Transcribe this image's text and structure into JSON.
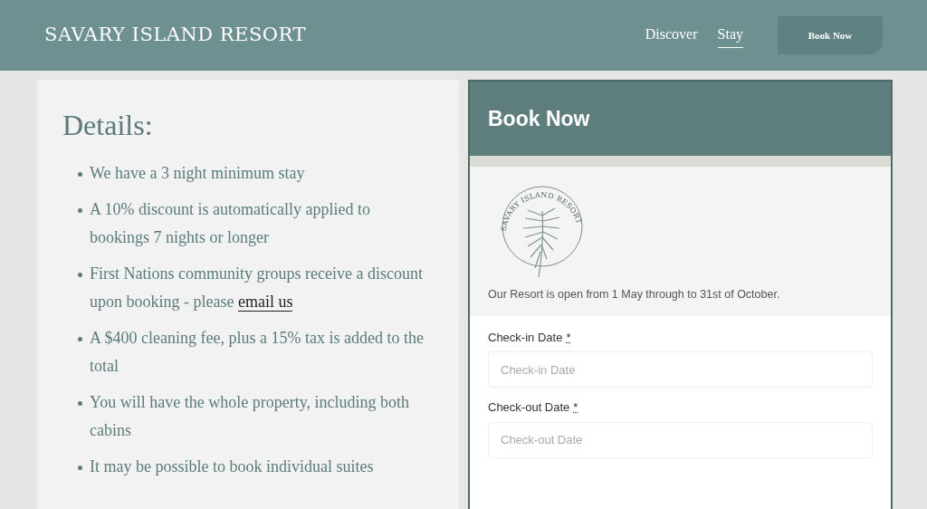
{
  "header": {
    "brand": "SAVARY ISLAND RESORT",
    "nav": [
      {
        "label": "Discover",
        "selected": false
      },
      {
        "label": "Stay",
        "selected": true
      }
    ],
    "cta": "Book Now"
  },
  "details": {
    "title": "Details:",
    "items": [
      {
        "text": "We have a 3 night minimum stay"
      },
      {
        "text": "A 10% discount is automatically applied to bookings 7 nights or longer"
      },
      {
        "text": "First Nations community groups receive a discount upon booking - please",
        "link": "email us"
      },
      {
        "text": "A $400 cleaning fee, plus a 15% tax is added to the total"
      },
      {
        "text": "You will have the whole property, including both cabins"
      },
      {
        "text": "It may be possible to book individual suites"
      }
    ]
  },
  "booking": {
    "title": "Book Now",
    "logo_text": "SAVARY ISLAND RESORT",
    "notice": "Our Resort is open from 1 May through to 31st of October.",
    "fields": [
      {
        "label": "Check-in Date",
        "required_mark": "*",
        "placeholder": "Check-in Date"
      },
      {
        "label": "Check-out Date",
        "required_mark": "*",
        "placeholder": "Check-out Date"
      }
    ]
  }
}
